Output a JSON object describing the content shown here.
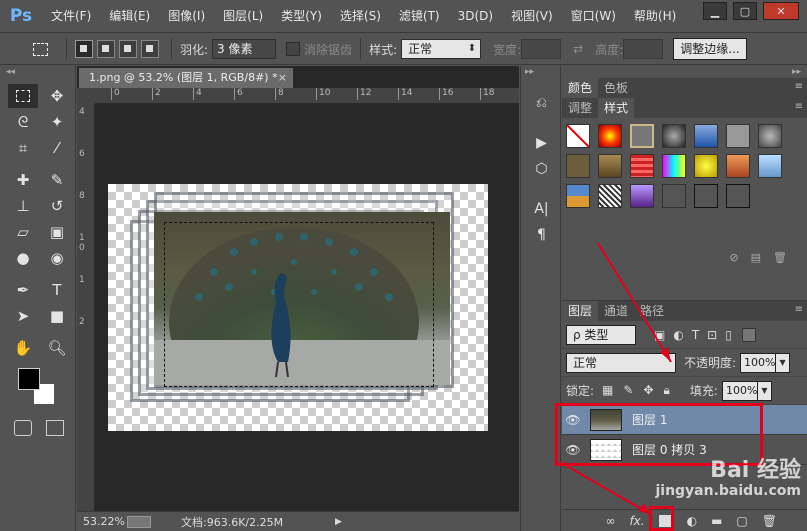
{
  "app": {
    "logo": "Ps"
  },
  "menu": [
    "文件(F)",
    "编辑(E)",
    "图像(I)",
    "图层(L)",
    "类型(Y)",
    "选择(S)",
    "滤镜(T)",
    "3D(D)",
    "视图(V)",
    "窗口(W)",
    "帮助(H)"
  ],
  "window_buttons": {
    "minimize": "▁",
    "restore": "▢",
    "close": "✕"
  },
  "options": {
    "feather_label": "羽化:",
    "feather_value": "3 像素",
    "antialias_label": "消除锯齿",
    "style_label": "样式:",
    "style_value": "正常",
    "width_label": "宽度:",
    "height_label": "高度:",
    "refine_button": "调整边缘..."
  },
  "document": {
    "tab_title": "1.png @ 53.2% (图层 1, RGB/8#) *",
    "tab_close": "×",
    "ruler_h": [
      "0",
      "2",
      "4",
      "6",
      "8",
      "10",
      "12",
      "14",
      "16",
      "18"
    ],
    "ruler_v": [
      "4",
      "6",
      "8",
      "1",
      "0",
      "1",
      "2"
    ]
  },
  "status": {
    "zoom": "53.22%",
    "doc_info": "文档:963.6K/2.25M"
  },
  "panels": {
    "color_tabs": [
      "颜色",
      "色板"
    ],
    "style_tabs": [
      "调整",
      "样式"
    ],
    "layer_tabs": [
      "图层",
      "通道",
      "路径"
    ],
    "kind_filter": "ρ 类型",
    "blend_mode": "正常",
    "opacity_label": "不透明度:",
    "opacity_value": "100%",
    "lock_label": "锁定:",
    "fill_label": "填充:",
    "fill_value": "100%",
    "layers": [
      {
        "name": "图层 1",
        "selected": true
      },
      {
        "name": "图层 0 拷贝 3",
        "selected": false
      }
    ],
    "footer_icons": [
      "link-icon",
      "fx-icon",
      "mask-icon",
      "adjustment-icon",
      "folder-icon",
      "new-layer-icon",
      "trash-icon"
    ]
  },
  "watermark": {
    "main": "Bai 经验",
    "sub": "jingyan.baidu.com"
  },
  "accent_colors": {
    "selected_layer": "#7089a8",
    "annotation_red": "#e3001b",
    "ps_blue": "#6fb6ff"
  }
}
